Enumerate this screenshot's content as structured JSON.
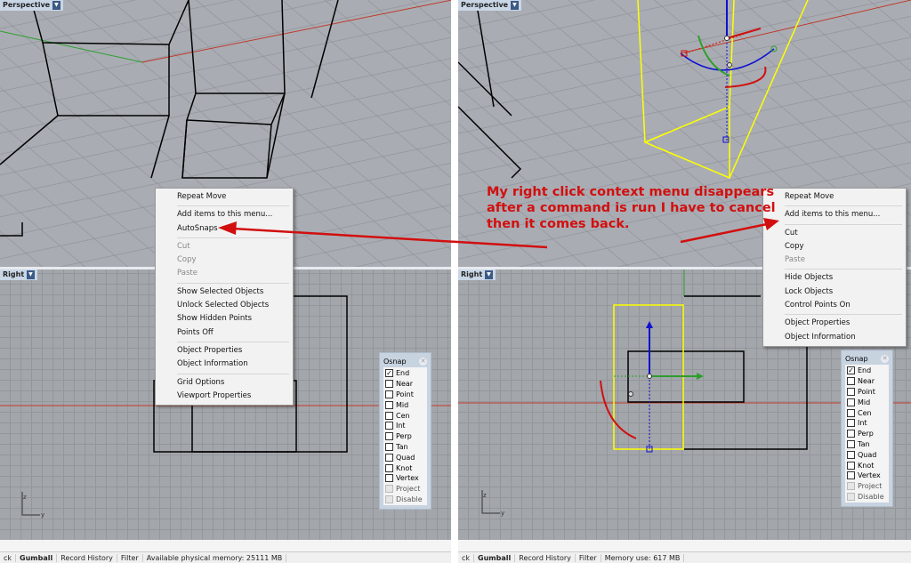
{
  "left": {
    "perspective_label": "Perspective",
    "right_label": "Right",
    "context_menu": [
      {
        "label": "Repeat Move",
        "enabled": true,
        "group": 0
      },
      {
        "label": "Add items to this menu...",
        "enabled": true,
        "group": 1
      },
      {
        "label": "AutoSnaps",
        "enabled": true,
        "group": 1
      },
      {
        "label": "Cut",
        "enabled": false,
        "group": 2
      },
      {
        "label": "Copy",
        "enabled": false,
        "group": 2
      },
      {
        "label": "Paste",
        "enabled": false,
        "group": 2
      },
      {
        "label": "Show Selected Objects",
        "enabled": true,
        "group": 3
      },
      {
        "label": "Unlock Selected Objects",
        "enabled": true,
        "group": 3
      },
      {
        "label": "Show Hidden Points",
        "enabled": true,
        "group": 3
      },
      {
        "label": "Points Off",
        "enabled": true,
        "group": 3
      },
      {
        "label": "Object Properties",
        "enabled": true,
        "group": 4
      },
      {
        "label": "Object Information",
        "enabled": true,
        "group": 4
      },
      {
        "label": "Grid Options",
        "enabled": true,
        "group": 5
      },
      {
        "label": "Viewport Properties",
        "enabled": true,
        "group": 5
      }
    ],
    "status": [
      "ck",
      "Gumball",
      "Record History",
      "Filter",
      "Available physical memory: 25111 MB"
    ]
  },
  "right": {
    "perspective_label": "Perspective",
    "right_label": "Right",
    "context_menu": [
      {
        "label": "Repeat Move",
        "enabled": true,
        "group": 0
      },
      {
        "label": "Add items to this menu...",
        "enabled": true,
        "group": 1
      },
      {
        "label": "Cut",
        "enabled": true,
        "group": 2
      },
      {
        "label": "Copy",
        "enabled": true,
        "group": 2
      },
      {
        "label": "Paste",
        "enabled": false,
        "group": 2
      },
      {
        "label": "Hide Objects",
        "enabled": true,
        "group": 3
      },
      {
        "label": "Lock Objects",
        "enabled": true,
        "group": 3
      },
      {
        "label": "Control Points On",
        "enabled": true,
        "group": 3
      },
      {
        "label": "Object Properties",
        "enabled": true,
        "group": 4
      },
      {
        "label": "Object Information",
        "enabled": true,
        "group": 4
      }
    ],
    "status": [
      "ck",
      "Gumball",
      "Record History",
      "Filter",
      "Memory use: 617 MB"
    ]
  },
  "osnap": {
    "title": "Osnap",
    "items": [
      {
        "label": "End",
        "checked": true,
        "enabled": true
      },
      {
        "label": "Near",
        "checked": false,
        "enabled": true
      },
      {
        "label": "Point",
        "checked": false,
        "enabled": true
      },
      {
        "label": "Mid",
        "checked": false,
        "enabled": true
      },
      {
        "label": "Cen",
        "checked": false,
        "enabled": true
      },
      {
        "label": "Int",
        "checked": false,
        "enabled": true
      },
      {
        "label": "Perp",
        "checked": false,
        "enabled": true
      },
      {
        "label": "Tan",
        "checked": false,
        "enabled": true
      },
      {
        "label": "Quad",
        "checked": false,
        "enabled": true
      },
      {
        "label": "Knot",
        "checked": false,
        "enabled": true
      },
      {
        "label": "Vertex",
        "checked": false,
        "enabled": true
      },
      {
        "label": "Project",
        "checked": false,
        "enabled": false
      },
      {
        "label": "Disable",
        "checked": false,
        "enabled": false
      }
    ]
  },
  "annotation": {
    "lines": [
      "My right click context menu disappears",
      "after a command is run I have to cancel",
      "then it comes back."
    ]
  },
  "colors": {
    "annotation": "#d20f0f",
    "selection": "#ffff00",
    "x_axis": "#c0392b",
    "y_axis": "#2e9e2e"
  }
}
